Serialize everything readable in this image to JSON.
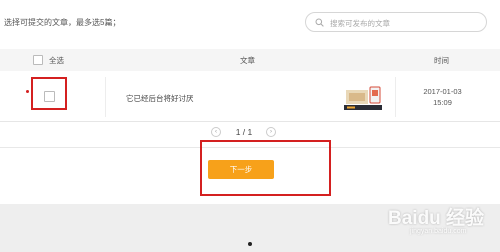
{
  "page": {
    "hint": "选择可提交的文章，最多选5篇；",
    "search_placeholder": "搜索可发布的文章"
  },
  "table": {
    "header": {
      "select_all": "全选",
      "article": "文章",
      "time": "时间"
    },
    "rows": [
      {
        "title": "它已经后台将好讨厌",
        "date": "2017-01-03",
        "clock": "15:09"
      }
    ]
  },
  "pagination": {
    "text": "1 / 1",
    "prev": "‹",
    "next": "›"
  },
  "actions": {
    "next_label": "下一步"
  },
  "watermark": {
    "text": "Baidu 经验",
    "sub": "jingyan.baidu.com"
  },
  "colors": {
    "accent": "#f7a11a",
    "highlight": "#d42020",
    "header_bg": "#f5f5f5"
  },
  "icons": {
    "search": "search-icon"
  }
}
